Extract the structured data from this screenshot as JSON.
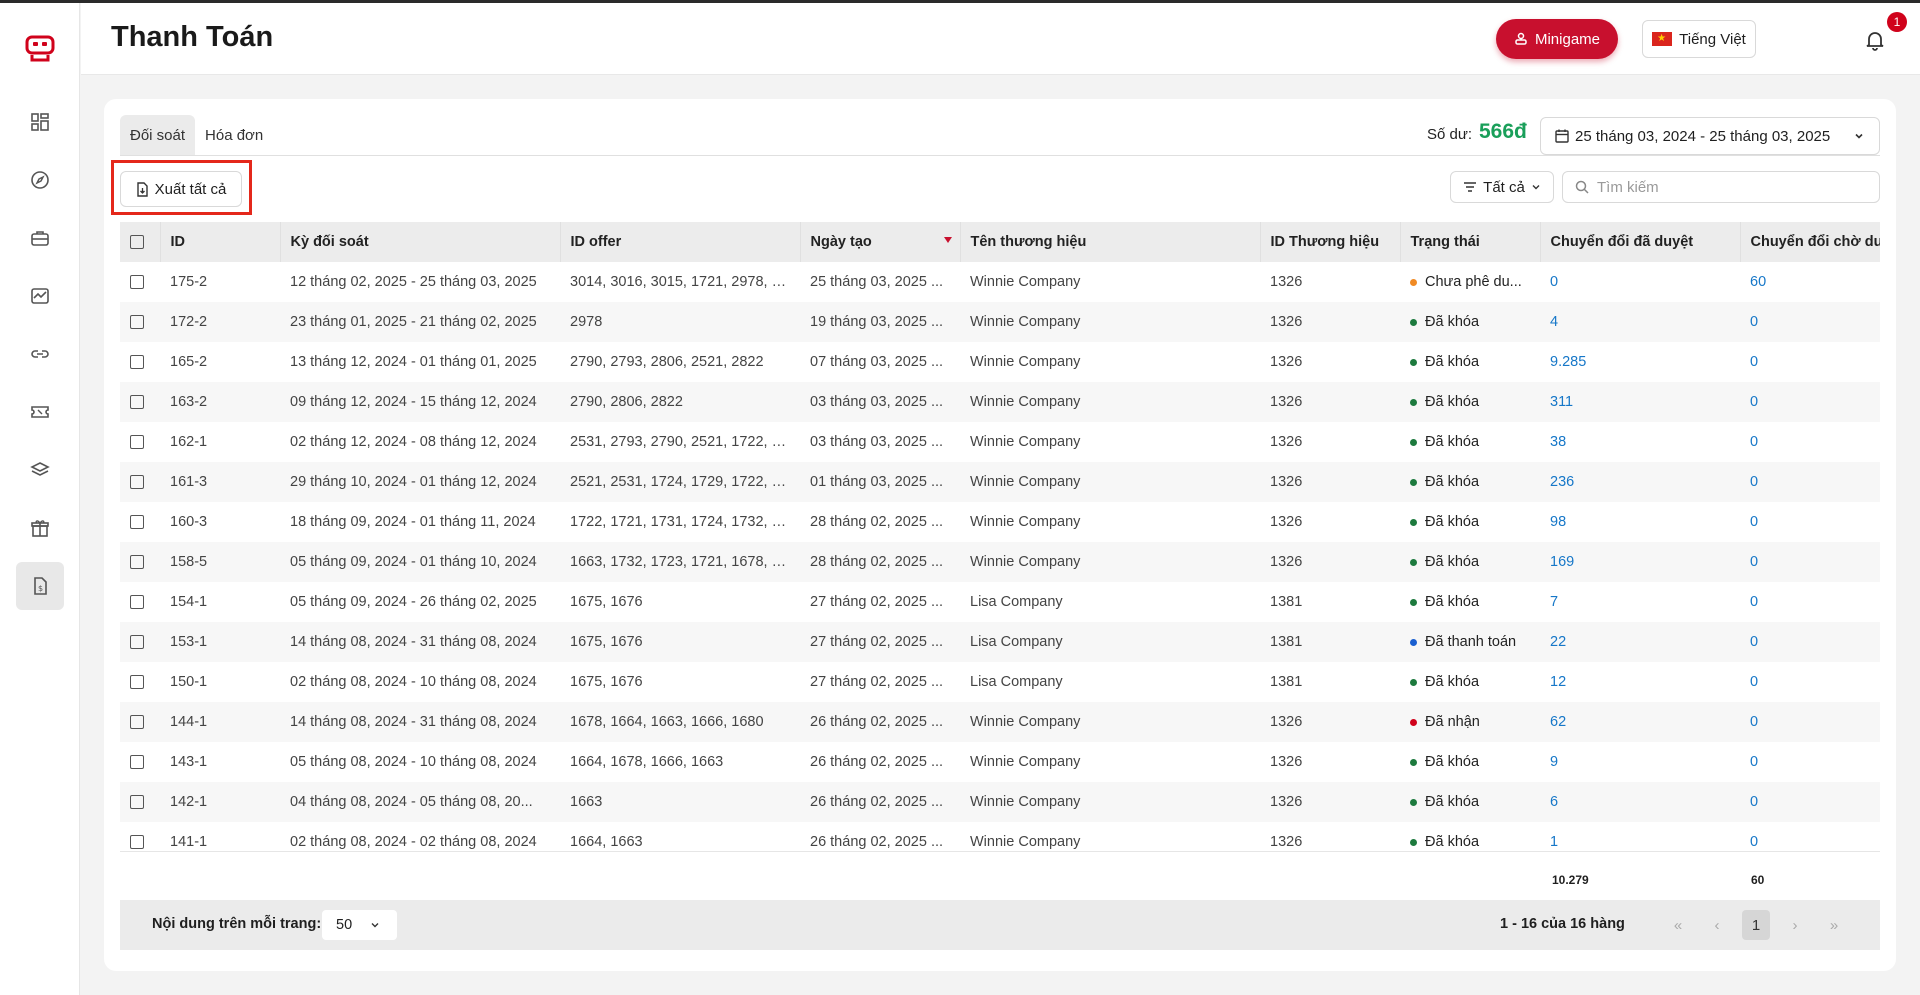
{
  "header": {
    "title": "Thanh Toán",
    "minigame_label": "Minigame",
    "language_label": "Tiếng Việt",
    "notification_count": "1"
  },
  "sidebar": {
    "items": [
      {
        "icon": "dashboard-icon"
      },
      {
        "icon": "compass-icon"
      },
      {
        "icon": "briefcase-icon"
      },
      {
        "icon": "chart-icon"
      },
      {
        "icon": "link-icon"
      },
      {
        "icon": "ticket-icon"
      },
      {
        "icon": "layers-icon"
      },
      {
        "icon": "gift-icon"
      },
      {
        "icon": "payment-document-icon",
        "active": true
      }
    ]
  },
  "tabs": [
    {
      "label": "Đối soát",
      "active": true
    },
    {
      "label": "Hóa đơn",
      "active": false
    }
  ],
  "balance": {
    "label": "Số dư:",
    "value": "566đ"
  },
  "date_range": "25 tháng 03, 2024 - 25 tháng 03, 2025",
  "toolbar": {
    "export_label": "Xuất tất cả",
    "filter_label": "Tất cả",
    "search_placeholder": "Tìm kiếm"
  },
  "table": {
    "columns": [
      "ID",
      "Kỳ đối soát",
      "ID offer",
      "Ngày tạo",
      "Tên thương hiệu",
      "ID Thương hiệu",
      "Trạng thái",
      "Chuyển đổi đã duyệt",
      "Chuyển đổi chờ duyệt"
    ],
    "rows": [
      {
        "id": "175-2",
        "period": "12 tháng 02, 2025 - 25 tháng 03, 2025",
        "offers": "3014, 3016, 3015, 1721, 2978, 2...",
        "created": "25 tháng 03, 2025 ...",
        "brand": "Winnie Company",
        "brand_id": "1326",
        "status": "Chưa phê du...",
        "status_color": "#f08a24",
        "approved": "0",
        "pending": "60"
      },
      {
        "id": "172-2",
        "period": "23 tháng 01, 2025 - 21 tháng 02, 2025",
        "offers": "2978",
        "created": "19 tháng 03, 2025 ...",
        "brand": "Winnie Company",
        "brand_id": "1326",
        "status": "Đã khóa",
        "status_color": "#1d7a3e",
        "approved": "4",
        "pending": "0"
      },
      {
        "id": "165-2",
        "period": "13 tháng 12, 2024 - 01 tháng 01, 2025",
        "offers": "2790, 2793, 2806, 2521, 2822",
        "created": "07 tháng 03, 2025 ...",
        "brand": "Winnie Company",
        "brand_id": "1326",
        "status": "Đã khóa",
        "status_color": "#1d7a3e",
        "approved": "9.285",
        "pending": "0"
      },
      {
        "id": "163-2",
        "period": "09 tháng 12, 2024 - 15 tháng 12, 2024",
        "offers": "2790, 2806, 2822",
        "created": "03 tháng 03, 2025 ...",
        "brand": "Winnie Company",
        "brand_id": "1326",
        "status": "Đã khóa",
        "status_color": "#1d7a3e",
        "approved": "311",
        "pending": "0"
      },
      {
        "id": "162-1",
        "period": "02 tháng 12, 2024 - 08 tháng 12, 2024",
        "offers": "2531, 2793, 2790, 2521, 1722, 1...",
        "created": "03 tháng 03, 2025 ...",
        "brand": "Winnie Company",
        "brand_id": "1326",
        "status": "Đã khóa",
        "status_color": "#1d7a3e",
        "approved": "38",
        "pending": "0"
      },
      {
        "id": "161-3",
        "period": "29 tháng 10, 2024 - 01 tháng 12, 2024",
        "offers": "2521, 2531, 1724, 1729, 1722, 1...",
        "created": "01 tháng 03, 2025 ...",
        "brand": "Winnie Company",
        "brand_id": "1326",
        "status": "Đã khóa",
        "status_color": "#1d7a3e",
        "approved": "236",
        "pending": "0"
      },
      {
        "id": "160-3",
        "period": "18 tháng 09, 2024 - 01 tháng 11, 2024",
        "offers": "1722, 1721, 1731, 1724, 1732, 17...",
        "created": "28 tháng 02, 2025 ...",
        "brand": "Winnie Company",
        "brand_id": "1326",
        "status": "Đã khóa",
        "status_color": "#1d7a3e",
        "approved": "98",
        "pending": "0"
      },
      {
        "id": "158-5",
        "period": "05 tháng 09, 2024 - 01 tháng 10, 2024",
        "offers": "1663, 1732, 1723, 1721, 1678, 1...",
        "created": "28 tháng 02, 2025 ...",
        "brand": "Winnie Company",
        "brand_id": "1326",
        "status": "Đã khóa",
        "status_color": "#1d7a3e",
        "approved": "169",
        "pending": "0"
      },
      {
        "id": "154-1",
        "period": "05 tháng 09, 2024 - 26 tháng 02, 2025",
        "offers": "1675, 1676",
        "created": "27 tháng 02, 2025 ...",
        "brand": "Lisa Company",
        "brand_id": "1381",
        "status": "Đã khóa",
        "status_color": "#1d7a3e",
        "approved": "7",
        "pending": "0"
      },
      {
        "id": "153-1",
        "period": "14 tháng 08, 2024 - 31 tháng 08, 2024",
        "offers": "1675, 1676",
        "created": "27 tháng 02, 2025 ...",
        "brand": "Lisa Company",
        "brand_id": "1381",
        "status": "Đã thanh toán",
        "status_color": "#1a5fd0",
        "approved": "22",
        "pending": "0"
      },
      {
        "id": "150-1",
        "period": "02 tháng 08, 2024 - 10 tháng 08, 2024",
        "offers": "1675, 1676",
        "created": "27 tháng 02, 2025 ...",
        "brand": "Lisa Company",
        "brand_id": "1381",
        "status": "Đã khóa",
        "status_color": "#1d7a3e",
        "approved": "12",
        "pending": "0"
      },
      {
        "id": "144-1",
        "period": "14 tháng 08, 2024 - 31 tháng 08, 2024",
        "offers": "1678, 1664, 1663, 1666, 1680",
        "created": "26 tháng 02, 2025 ...",
        "brand": "Winnie Company",
        "brand_id": "1326",
        "status": "Đã nhận",
        "status_color": "#d0021b",
        "approved": "62",
        "pending": "0"
      },
      {
        "id": "143-1",
        "period": "05 tháng 08, 2024 - 10 tháng 08, 2024",
        "offers": "1664, 1678, 1666, 1663",
        "created": "26 tháng 02, 2025 ...",
        "brand": "Winnie Company",
        "brand_id": "1326",
        "status": "Đã khóa",
        "status_color": "#1d7a3e",
        "approved": "9",
        "pending": "0"
      },
      {
        "id": "142-1",
        "period": "04 tháng 08, 2024 - 05 tháng 08, 20...",
        "offers": "1663",
        "created": "26 tháng 02, 2025 ...",
        "brand": "Winnie Company",
        "brand_id": "1326",
        "status": "Đã khóa",
        "status_color": "#1d7a3e",
        "approved": "6",
        "pending": "0"
      },
      {
        "id": "141-1",
        "period": "02 tháng 08, 2024 - 02 tháng 08, 2024",
        "offers": "1664, 1663",
        "created": "26 tháng 02, 2025 ...",
        "brand": "Winnie Company",
        "brand_id": "1326",
        "status": "Đã khóa",
        "status_color": "#1d7a3e",
        "approved": "1",
        "pending": "0"
      }
    ],
    "totals": {
      "approved": "10.279",
      "pending": "60"
    }
  },
  "footer": {
    "per_page_label": "Nội dung trên mỗi trang:",
    "per_page_value": "50",
    "row_info": "1 - 16 của 16 hàng",
    "current_page": "1"
  }
}
